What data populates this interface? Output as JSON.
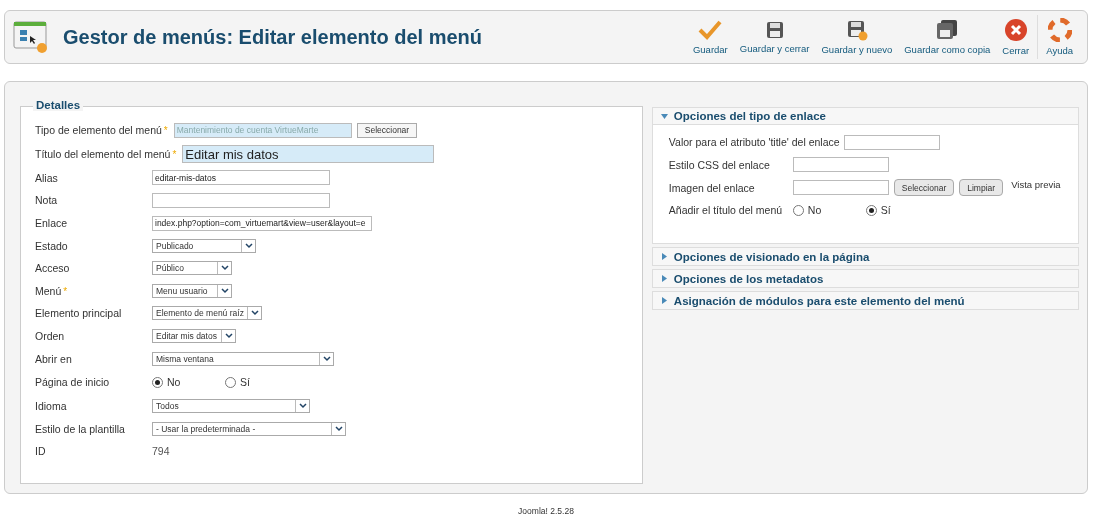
{
  "header": {
    "title": "Gestor de menús: Editar elemento del menú"
  },
  "toolbar": [
    {
      "label": "Guardar"
    },
    {
      "label": "Guardar y cerrar"
    },
    {
      "label": "Guardar y nuevo"
    },
    {
      "label": "Guardar como copia"
    },
    {
      "label": "Cerrar"
    },
    {
      "label": "Ayuda"
    }
  ],
  "details": {
    "legend": "Detalles",
    "fields": [
      {
        "kind": "readonly",
        "label": "Tipo de elemento del menú",
        "required_mark": "*",
        "value": "Mantenimiento de cuenta VirtueMarte",
        "button": "Seleccionar"
      },
      {
        "kind": "title",
        "label": "Título del elemento del menú",
        "required_mark": "*",
        "value": "Editar mis datos"
      },
      {
        "kind": "text",
        "label": "Alias",
        "value": "editar-mis-datos"
      },
      {
        "kind": "text",
        "label": "Nota"
      },
      {
        "kind": "text",
        "label": "Enlace",
        "value": "index.php?option=com_virtuemart&view=user&layout=e"
      },
      {
        "kind": "select",
        "label": "Estado",
        "value": "Publicado"
      },
      {
        "kind": "select",
        "label": "Acceso",
        "value": "Público"
      },
      {
        "kind": "select",
        "label": "Menú",
        "required_mark": "*",
        "value": "Menu usuario"
      },
      {
        "kind": "select",
        "label": "Elemento principal",
        "value": "Elemento de menú raíz"
      },
      {
        "kind": "select",
        "label": "Orden",
        "value": "Editar mis datos"
      },
      {
        "kind": "select",
        "label": "Abrir en",
        "value": "Misma ventana"
      },
      {
        "kind": "radio",
        "label": "Página de inicio",
        "options": [
          {
            "label": "No",
            "selected": true
          },
          {
            "label": "Sí",
            "selected": false
          }
        ]
      },
      {
        "kind": "select",
        "label": "Idioma",
        "value": "Todos"
      },
      {
        "kind": "select",
        "label": "Estilo de la plantilla",
        "value": "- Usar la predeterminada -"
      },
      {
        "kind": "static",
        "label": "ID",
        "value": "794"
      }
    ]
  },
  "panels": [
    {
      "title": "Opciones del tipo de enlace",
      "expanded": true,
      "fields": [
        {
          "kind": "text",
          "label": "Valor para el atributo 'title' del enlace"
        },
        {
          "kind": "text",
          "label": "Estilo CSS del enlace"
        },
        {
          "kind": "image",
          "label": "Imagen del enlace",
          "buttons": [
            "Seleccionar",
            "Limpiar"
          ],
          "note": "Vista previa"
        },
        {
          "kind": "radio",
          "label": "Añadir el título del menú",
          "options": [
            {
              "label": "No",
              "selected": false
            },
            {
              "label": "Sí",
              "selected": true
            }
          ]
        }
      ]
    },
    {
      "title": "Opciones de visionado en la página",
      "expanded": false
    },
    {
      "title": "Opciones de los metadatos",
      "expanded": false
    },
    {
      "title": "Asignación de módulos para este elemento del menú",
      "expanded": false
    }
  ],
  "footer": {
    "text": "Joomla! 2.5.28"
  }
}
